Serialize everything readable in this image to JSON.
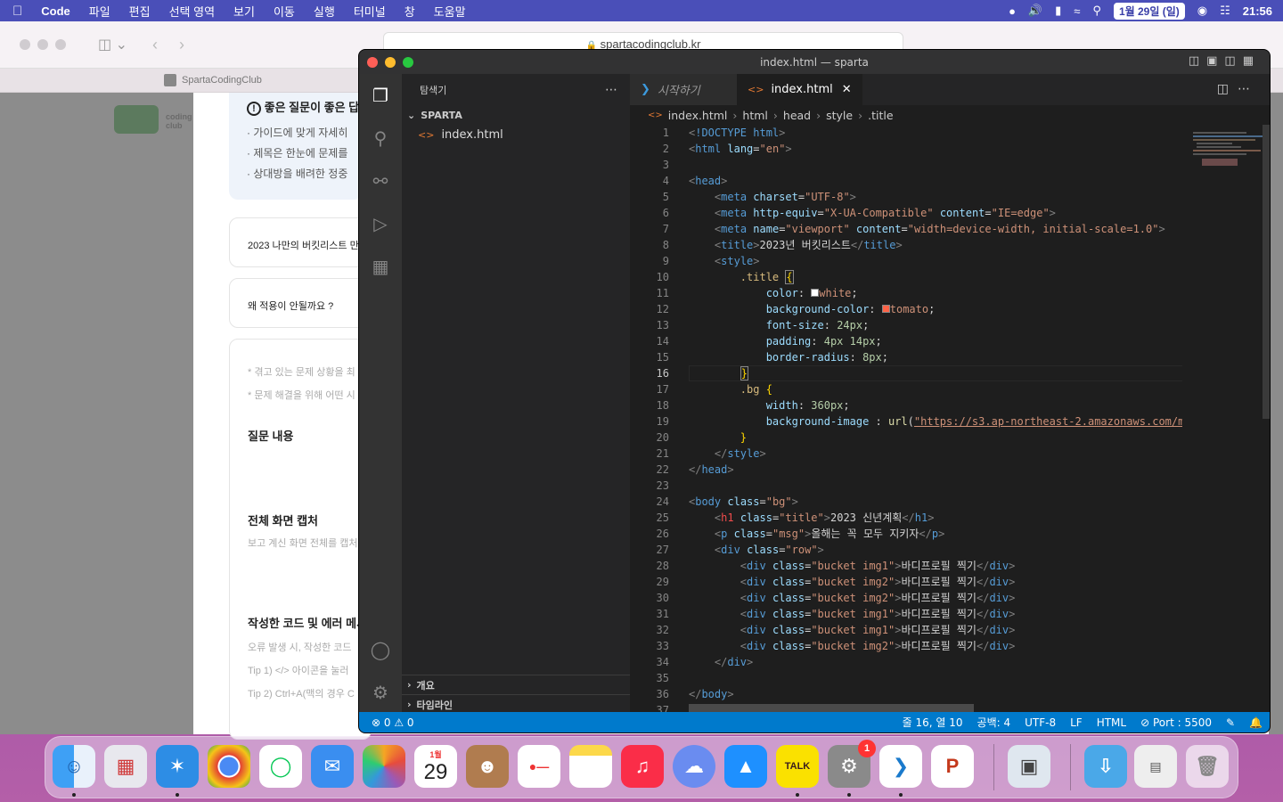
{
  "menubar": {
    "apple_icon": "apple-icon",
    "app_name": "Code",
    "items": [
      "파일",
      "편집",
      "선택 영역",
      "보기",
      "이동",
      "실행",
      "터미널",
      "창",
      "도움말"
    ],
    "date": "1월 29일 (일)",
    "time": "21:56"
  },
  "safari": {
    "url": "spartacodingclub.kr",
    "tab_title": "SpartaCodingClub",
    "logo_text": "coding club",
    "tip_heading": "좋은 질문이 좋은 답",
    "tip_lines": [
      "· 가이드에 맞게 자세히",
      "· 제목은 한눈에 문제를",
      "· 상대방을 배려한 정중"
    ],
    "card1": "2023 나만의 버킷리스트 만",
    "card2": "왜 적용이 안될까요 ?",
    "form": {
      "hint1": "* 겪고 있는 문제 상황을 최",
      "hint2": "* 문제 해결을 위해 어떤 시",
      "q_content": "질문 내용",
      "capture_title": "전체 화면 캡처",
      "capture_hint": "보고 계신 화면 전체를 캡처",
      "code_title": "작성한 코드 및 에러 메시",
      "code_hint": "오류 발생 시, 작성한 코드 ",
      "tip1": "Tip 1) </> 아이콘을 눌러 ",
      "tip2": "Tip 2) Ctrl+A(맥의 경우 C"
    }
  },
  "vscode": {
    "window_title": "index.html — sparta",
    "explorer_label": "탐색기",
    "folder": "SPARTA",
    "file": "index.html",
    "outline": "개요",
    "timeline": "타임라인",
    "tab_welcome": "시작하기",
    "tab_active": "index.html",
    "breadcrumbs": [
      "index.html",
      "html",
      "head",
      "style",
      ".title"
    ],
    "status": {
      "problems": "0",
      "warnings": "0",
      "cursor": "줄 16, 열 10",
      "spaces": "공백: 4",
      "encoding": "UTF-8",
      "eol": "LF",
      "language": "HTML",
      "port": "Port : 5500"
    },
    "code_lines": [
      "1",
      "2",
      "3",
      "4",
      "5",
      "6",
      "7",
      "8",
      "9",
      "10",
      "11",
      "12",
      "13",
      "14",
      "15",
      "16",
      "17",
      "18",
      "19",
      "20",
      "21",
      "22",
      "23",
      "24",
      "25",
      "26",
      "27",
      "28",
      "29",
      "30",
      "31",
      "32",
      "33",
      "34",
      "35",
      "36",
      "37"
    ]
  },
  "dock": {
    "calendar_month": "1월",
    "calendar_day": "29",
    "badge": "1",
    "talk": "TALK"
  }
}
